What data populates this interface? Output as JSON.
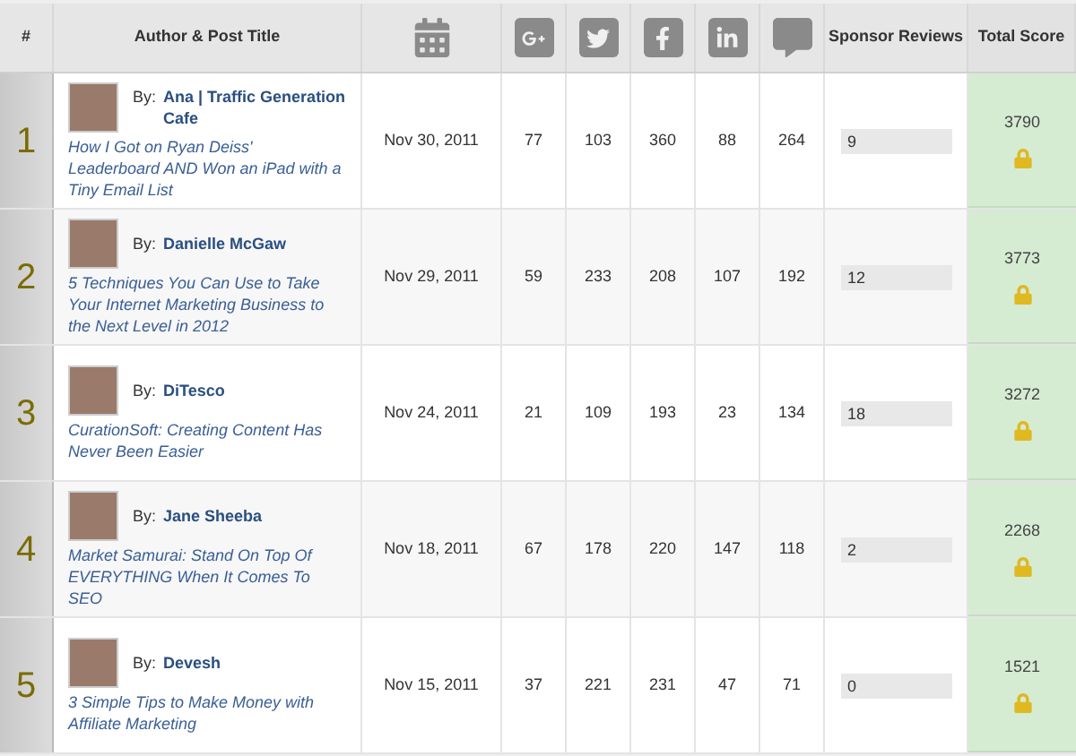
{
  "table": {
    "columns": [
      {
        "label": "#",
        "kind": "text"
      },
      {
        "label": "Author & Post Title",
        "kind": "text"
      },
      {
        "kind": "calendar"
      },
      {
        "kind": "gplus"
      },
      {
        "kind": "twitter"
      },
      {
        "kind": "facebook"
      },
      {
        "kind": "linkedin"
      },
      {
        "kind": "comments"
      },
      {
        "label": "Sponsor Reviews",
        "kind": "text"
      },
      {
        "label": "Total Score",
        "kind": "text"
      }
    ],
    "rows": [
      {
        "rank": "1",
        "by": "By:",
        "author": "Ana | Traffic Generation Cafe",
        "title": "How I Got on Ryan Deiss' Leaderboard AND Won an iPad with a Tiny Email List",
        "date": "Nov 30, 2011",
        "counts": [
          "77",
          "103",
          "360",
          "88",
          "264"
        ],
        "sponsor_reviews": "9",
        "total_score": "3790"
      },
      {
        "rank": "2",
        "by": "By:",
        "author": "Danielle McGaw",
        "title": "5 Techniques You Can Use to Take Your Internet Marketing Business to the Next Level in 2012",
        "date": "Nov 29, 2011",
        "counts": [
          "59",
          "233",
          "208",
          "107",
          "192"
        ],
        "sponsor_reviews": "12",
        "total_score": "3773"
      },
      {
        "rank": "3",
        "by": "By:",
        "author": "DiTesco",
        "title": "CurationSoft: Creating Content Has Never Been Easier",
        "date": "Nov 24, 2011",
        "counts": [
          "21",
          "109",
          "193",
          "23",
          "134"
        ],
        "sponsor_reviews": "18",
        "total_score": "3272"
      },
      {
        "rank": "4",
        "by": "By:",
        "author": "Jane Sheeba",
        "title": "Market Samurai: Stand On Top Of EVERYTHING When It Comes To SEO",
        "date": "Nov 18, 2011",
        "counts": [
          "67",
          "178",
          "220",
          "147",
          "118"
        ],
        "sponsor_reviews": "2",
        "total_score": "2268"
      },
      {
        "rank": "5",
        "by": "By:",
        "author": "Devesh",
        "title": "3 Simple Tips to Make Money with Affiliate Marketing",
        "date": "Nov 15, 2011",
        "counts": [
          "37",
          "221",
          "231",
          "47",
          "71"
        ],
        "sponsor_reviews": "0",
        "total_score": "1521"
      }
    ]
  }
}
